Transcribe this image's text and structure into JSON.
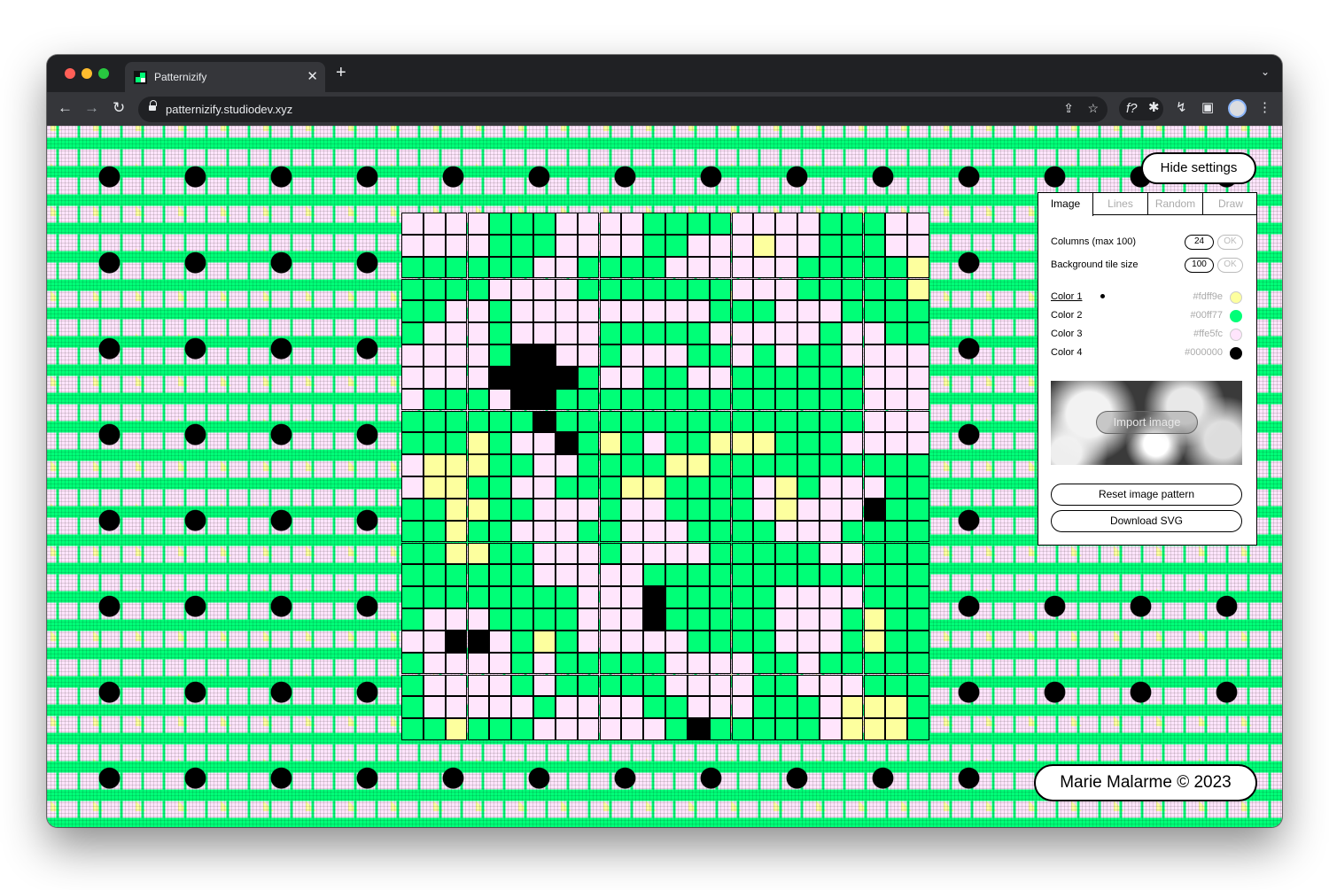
{
  "browser": {
    "tab_title": "Patternizify",
    "url": "patternizify.studiodev.xyz"
  },
  "app": {
    "hide_settings_label": "Hide settings",
    "credit": "Marie Malarme © 2023",
    "tabs": [
      {
        "label": "Image",
        "active": true
      },
      {
        "label": "Lines",
        "active": false
      },
      {
        "label": "Random",
        "active": false
      },
      {
        "label": "Draw",
        "active": false
      }
    ],
    "columns_label": "Columns (max 100)",
    "columns_value": "24",
    "tile_size_label": "Background tile size",
    "tile_size_value": "100",
    "ok_label": "OK",
    "colors": [
      {
        "label": "Color 1",
        "hex": "#fdff9e",
        "selected": true
      },
      {
        "label": "Color 2",
        "hex": "#00ff77",
        "selected": false
      },
      {
        "label": "Color 3",
        "hex": "#ffe5fc",
        "selected": false
      },
      {
        "label": "Color 4",
        "hex": "#000000",
        "selected": false
      }
    ],
    "import_image_label": "Import image",
    "reset_label": "Reset image pattern",
    "download_label": "Download SVG"
  },
  "pattern": {
    "palette": {
      "p": "#ffe5fc",
      "g": "#00ff77",
      "y": "#fdff9e",
      "k": "#000000"
    },
    "rows": [
      "ppppgggppppggggppppgggpp",
      "ppppgggppppggpppyppgggpp",
      "ggggggppggggppppppgggggy",
      "ggggppppgggggggpppgggggy",
      "ggppgpppppppppgggpppgggg",
      "gpppgppppgggggpppppgppgg",
      "ppppgkkppgpppggpgpggpppp",
      "ppppkkkkgppggppggggggppp",
      "pgggpkkggggggggggggggpppp",
      "ggggggkggggggggggggggppp",
      "gggygppkgygpggyyygggpppp",
      "pyyyggppggggyygggggggggg",
      "pyyggppgggyyggggpygpppgg",
      "ggyyggpppgppggggpypppkgg",
      "ggyggpppggpppggggpppggg",
      "ggyyggpppgppppgggggppggg",
      "ggggggpppppgggggggggggg",
      "ggggggggpppkgggggppppgg",
      "gpppggggpppkgggggpppgyg",
      "ppkkpgygpppppggggpppgyg",
      "gppppgpgggggppppggpgggg",
      "gppppgpgggggppppggpppgg",
      "gpppppgppppggpppgggpyyy",
      "ggygggppppppgkgggggpyyy"
    ]
  }
}
